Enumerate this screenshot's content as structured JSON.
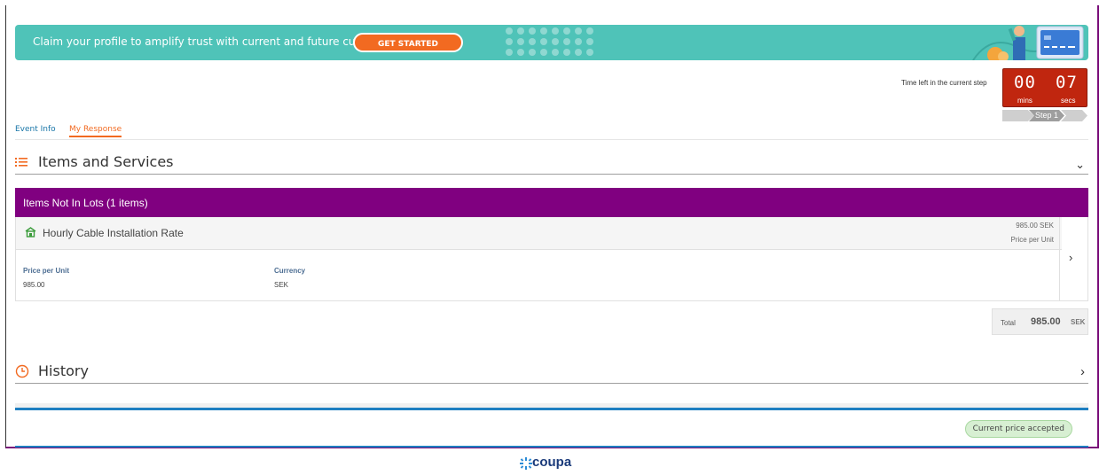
{
  "banner": {
    "text": "Claim your profile to amplify trust with current and future customers.",
    "cta_label": "GET STARTED"
  },
  "timer": {
    "label": "Time left in the current step",
    "mins": "00",
    "secs": "07",
    "mins_label": "mins",
    "secs_label": "secs",
    "step_label": "Step 1"
  },
  "tabs": [
    {
      "label": "Event Info"
    },
    {
      "label": "My Response"
    }
  ],
  "items_section": {
    "title": "Items and Services",
    "lots_title": "Items Not In Lots (1 items)",
    "item": {
      "name": "Hourly Cable Installation Rate",
      "price_summary": "985.00 SEK",
      "price_summary_label": "Price per Unit",
      "fields": {
        "price_label": "Price per Unit",
        "price_value": "985.00",
        "currency_label": "Currency",
        "currency_value": "SEK"
      }
    },
    "total": {
      "label": "Total",
      "value": "985.00",
      "currency": "SEK"
    }
  },
  "history": {
    "title": "History"
  },
  "status": {
    "badge": "Current price accepted"
  },
  "footer": {
    "logo": "coupa"
  },
  "colors": {
    "banner": "#4fc3b8",
    "cta": "#f26a21",
    "purple": "#800080",
    "timer": "#c0260f",
    "blue": "#1e7fc1"
  }
}
